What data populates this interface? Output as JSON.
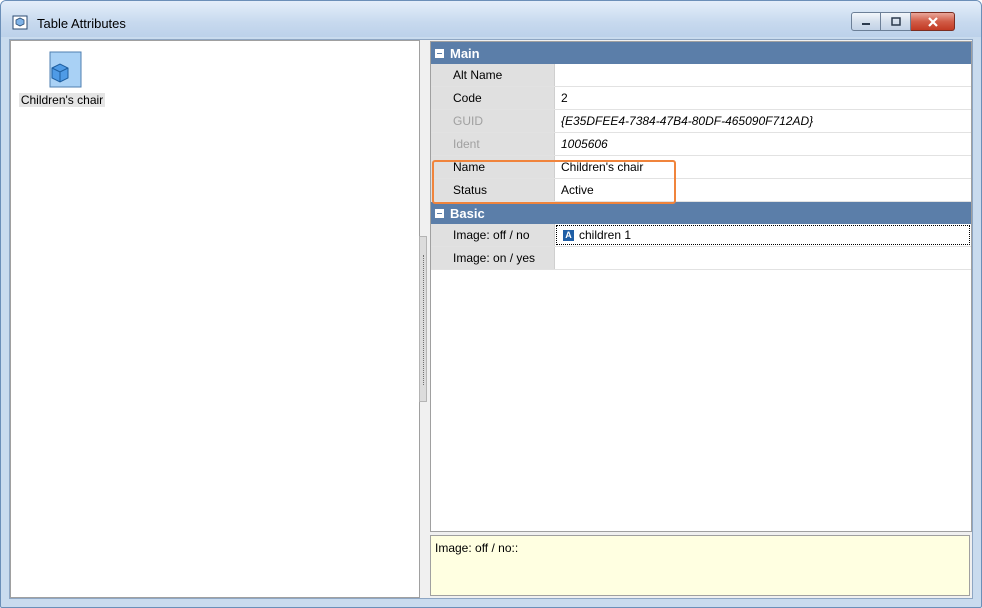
{
  "window": {
    "title": "Table Attributes",
    "title_icon": "table-attributes-icon",
    "buttons": [
      "minimize-icon",
      "restore-icon",
      "close-icon"
    ]
  },
  "left_pane": {
    "items": [
      {
        "label": "Children's chair",
        "icon": "cube-icon",
        "selected": true
      }
    ]
  },
  "property_grid": {
    "categories": [
      {
        "title": "Main",
        "rows": [
          {
            "name": "Alt Name",
            "value": ""
          },
          {
            "name": "Code",
            "value": "2"
          },
          {
            "name": "GUID",
            "value": "{E35DFEE4-7384-47B4-80DF-465090F712AD}"
          },
          {
            "name": "Ident",
            "value": "1005606"
          },
          {
            "name": "Name",
            "value": "Children's chair"
          },
          {
            "name": "Status",
            "value": "Active"
          }
        ]
      },
      {
        "title": "Basic",
        "rows": [
          {
            "name": "Image: off / no",
            "value": "children 1",
            "value_icon": "A"
          },
          {
            "name": "Image: on / yes",
            "value": ""
          }
        ]
      }
    ]
  },
  "description": {
    "text": "Image: off / no::"
  },
  "colors": {
    "category_header": "#5b7ea9",
    "highlight_border": "#f0843c",
    "description_bg": "#ffffe1"
  }
}
